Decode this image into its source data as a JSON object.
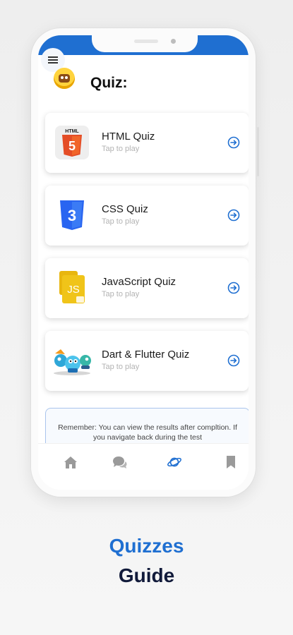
{
  "header": {
    "title": "Quiz:",
    "menu_icon": "hamburger-menu-icon",
    "logo_icon": "quiz-mascot-logo"
  },
  "quizzes": [
    {
      "title": "HTML Quiz",
      "subtitle": "Tap to play",
      "badge": "HTML",
      "icon": "html5-logo-icon"
    },
    {
      "title": "CSS Quiz",
      "subtitle": "Tap to play",
      "icon": "css3-logo-icon"
    },
    {
      "title": "JavaScript Quiz",
      "subtitle": "Tap to play",
      "badge": "JS",
      "icon": "javascript-file-icon"
    },
    {
      "title": "Dart & Flutter Quiz",
      "subtitle": "Tap to play",
      "icon": "dart-flutter-mascots-icon"
    }
  ],
  "notice": {
    "text": "Remember: You can view the results after compltion. If you navigate back during the test"
  },
  "bottom_nav": [
    {
      "icon": "home-icon",
      "active": false
    },
    {
      "icon": "chat-bubbles-icon",
      "active": false
    },
    {
      "icon": "planet-icon",
      "active": true
    },
    {
      "icon": "bookmark-icon",
      "active": false
    }
  ],
  "tagline": {
    "line1": "Quizzes",
    "line2": "Guide"
  },
  "colors": {
    "accent": "#1f6fd1",
    "html_orange": "#e44d26",
    "css_blue": "#2965f1",
    "js_yellow": "#f0c419",
    "nav_inactive": "#9a9a9a",
    "tagline_dark": "#111a3a"
  }
}
